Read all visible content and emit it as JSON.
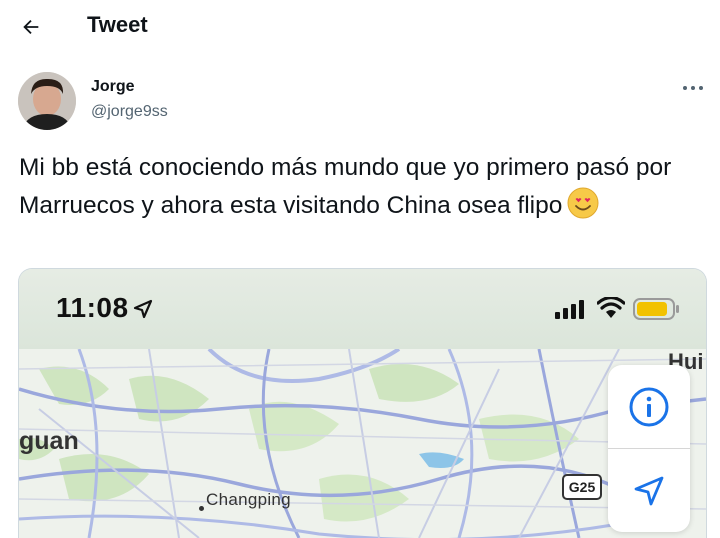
{
  "header": {
    "title": "Tweet",
    "back_icon": "arrow-left-icon"
  },
  "author": {
    "name": "Jorge",
    "handle": "@jorge9ss",
    "more_icon": "more-horizontal-icon"
  },
  "tweet": {
    "text": "Mi bb está conociendo más mundo que yo primero pasó por Marruecos y ahora esta visitando China osea flipo",
    "emoji": "smiling-face-with-heart-eyes"
  },
  "media": {
    "status_bar": {
      "time": "11:08",
      "icons": [
        "location-arrow-icon",
        "signal-icon",
        "wifi-icon",
        "battery-low-icon"
      ]
    },
    "map": {
      "labels": {
        "city_left": "guan",
        "town": "Changping",
        "city_right": "Hui",
        "road_shield": "G25"
      },
      "buttons": {
        "info_icon": "info-circle-icon",
        "locate_icon": "location-arrow-icon"
      }
    }
  },
  "colors": {
    "text": "#0f1419",
    "secondary": "#536471",
    "map_button_blue": "#1a73e8",
    "battery_yellow": "#f2c200"
  }
}
